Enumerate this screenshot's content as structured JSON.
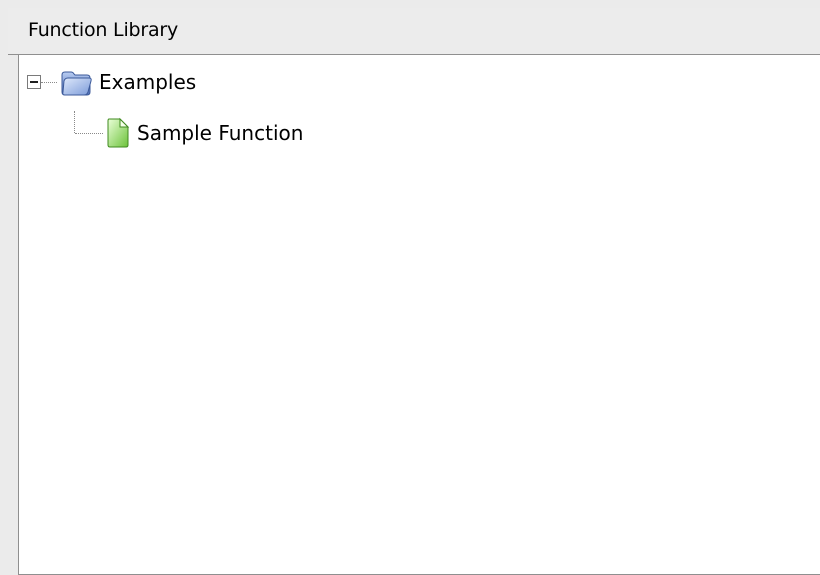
{
  "panel": {
    "title": "Function Library"
  },
  "tree": {
    "nodes": [
      {
        "label": "Examples",
        "icon": "folder-icon",
        "expanded": true,
        "children": [
          {
            "label": "Sample Function",
            "icon": "document-icon"
          }
        ]
      }
    ]
  },
  "colors": {
    "folder": "#6f8fce",
    "document": "#8bd15a",
    "border": "#8f8f8f",
    "header_bg": "#ececec"
  }
}
